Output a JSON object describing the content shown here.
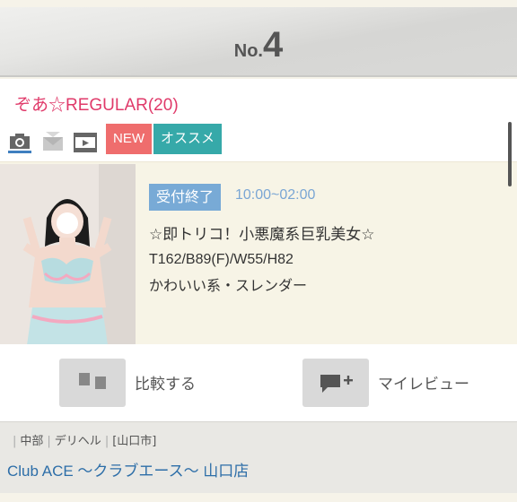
{
  "rank": {
    "prefix": "No.",
    "number": "4"
  },
  "girl": {
    "name": "ぞあ☆REGULAR(20)",
    "status": "受付終了",
    "hours": "10:00~02:00",
    "catchphrase": "☆即トリコ！小悪魔系巨乳美女☆",
    "specs": "T162/B89(F)/W55/H82",
    "type": "かわいい系・スレンダー"
  },
  "icons": [
    "camera-icon",
    "mail-icon",
    "video-icon"
  ],
  "tags": {
    "new": "NEW",
    "recommend": "オススメ"
  },
  "actions": {
    "compare": "比較する",
    "review": "マイレビュー"
  },
  "shop": {
    "crumbs": [
      "中部",
      "デリヘル",
      "[山口市]"
    ],
    "name": "Club ACE ～クラブエース～ 山口店"
  },
  "colors": {
    "name": "#e03a6a",
    "tag_new": "#ef6d6d",
    "tag_recommend": "#36a9a9",
    "status": "#78aad6",
    "shop_link": "#2d6ea8"
  }
}
